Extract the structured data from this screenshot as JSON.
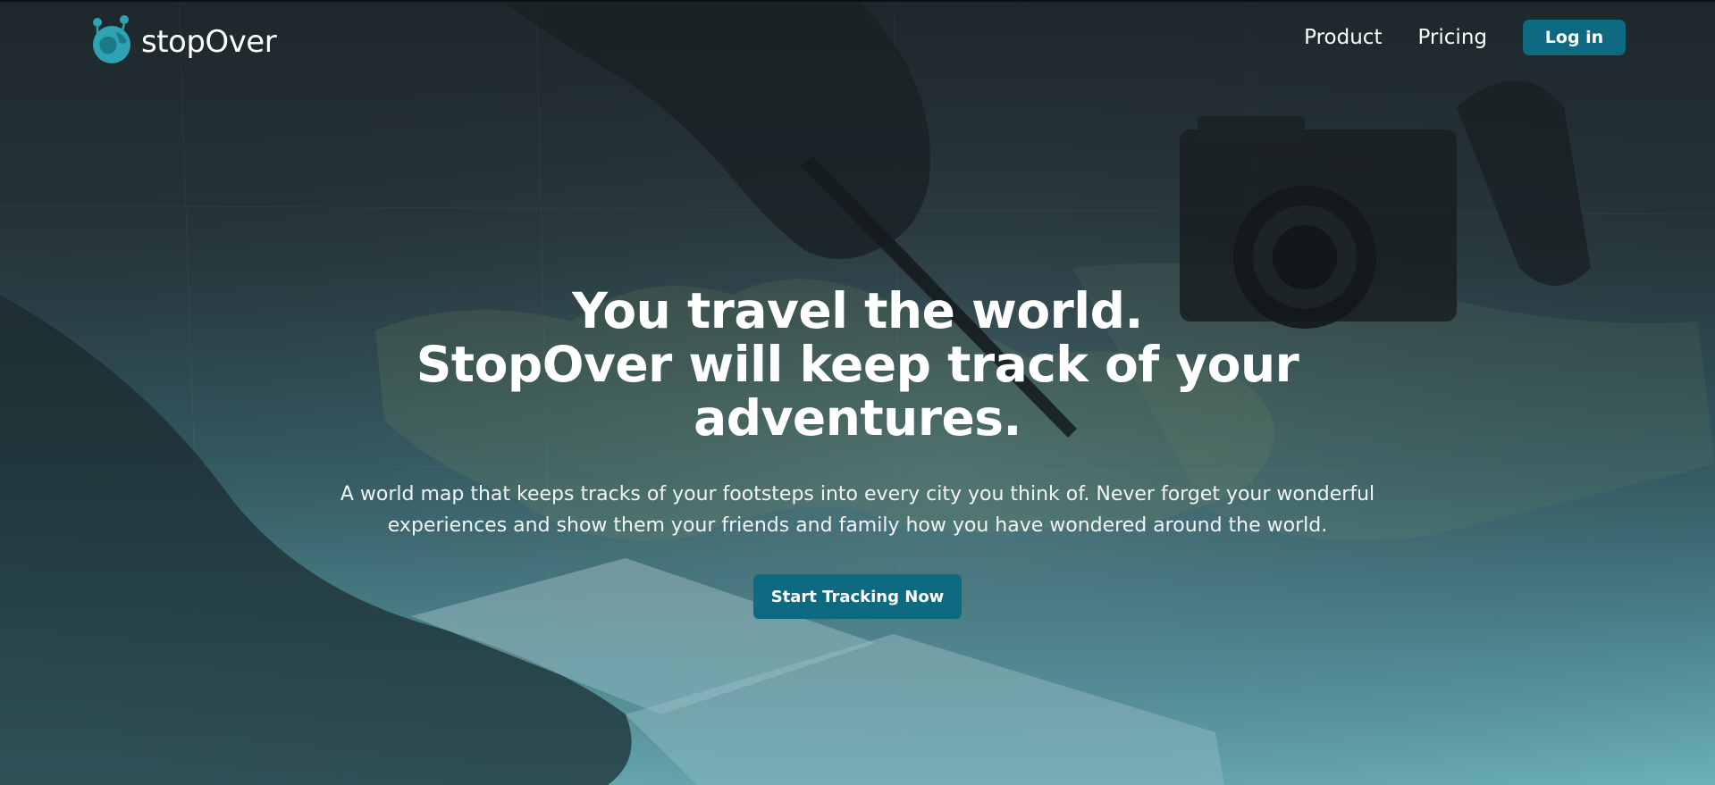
{
  "nav": {
    "brand": "stopOver",
    "links": [
      {
        "label": "Product"
      },
      {
        "label": "Pricing"
      }
    ],
    "login_label": "Log in"
  },
  "hero": {
    "headline_line1": "You travel the world.",
    "headline_line2": "StopOver will keep track of your",
    "headline_line3": "adventures.",
    "subtext_line1": "A world map that keeps tracks of your footsteps into every city you think of. Never forget your wonderful",
    "subtext_line2": "experiences and show them your friends and family how you have wondered around the world.",
    "cta_label": "Start Tracking Now"
  },
  "colors": {
    "accent": "#0e6a80",
    "text": "#ffffff"
  },
  "icons": {
    "logo": "globe-with-pins-icon"
  }
}
